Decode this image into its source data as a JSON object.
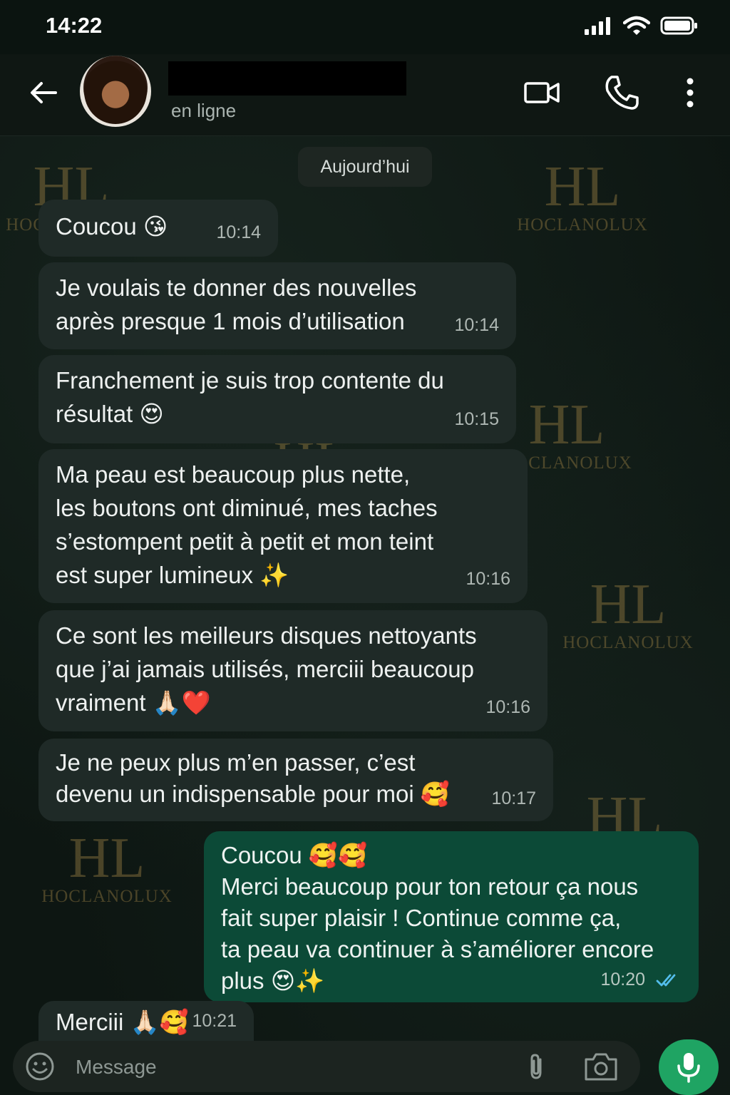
{
  "status_bar": {
    "time": "14:22"
  },
  "header": {
    "contact_status": "en ligne"
  },
  "watermark": {
    "text": "HOCLANOLUX",
    "monogram": "HL"
  },
  "date_separator": "Aujourd’hui",
  "messages": [
    {
      "direction": "in",
      "lines": [
        "Coucou 😘"
      ],
      "time": "10:14"
    },
    {
      "direction": "in",
      "lines": [
        "Je voulais te donner des nouvelles",
        "après presque 1 mois d’utilisation"
      ],
      "time": "10:14"
    },
    {
      "direction": "in",
      "lines": [
        "Franchement je suis trop contente du",
        "résultat 😍"
      ],
      "time": "10:15"
    },
    {
      "direction": "in",
      "lines": [
        "Ma peau est beaucoup plus nette,",
        "les boutons ont diminué, mes taches",
        "s’estompent petit à petit et mon teint",
        "est super lumineux ✨"
      ],
      "time": "10:16"
    },
    {
      "direction": "in",
      "lines": [
        "Ce sont les meilleurs disques nettoyants",
        "que j’ai jamais utilisés, merciii beaucoup",
        "vraiment 🙏🏻❤️"
      ],
      "time": "10:16"
    },
    {
      "direction": "in",
      "lines": [
        "Je ne peux plus m’en passer, c’est",
        "devenu un indispensable pour moi 🥰"
      ],
      "time": "10:17"
    },
    {
      "direction": "out",
      "lines": [
        "Coucou 🥰🥰",
        "Merci beaucoup pour ton retour ça nous",
        "fait super plaisir ! Continue comme ça,",
        "ta peau va continuer à s’améliorer encore",
        "plus 😍✨"
      ],
      "time": "10:20",
      "read": true
    },
    {
      "direction": "in",
      "lines": [
        "Merciii 🙏🏻🥰"
      ],
      "time": "10:21"
    }
  ],
  "composer": {
    "placeholder": "Message"
  },
  "colors": {
    "incoming_bubble": "#1f2a27",
    "outgoing_bubble": "#0c4a37",
    "mic_button": "#1fa463",
    "read_tick": "#53bdeb"
  }
}
